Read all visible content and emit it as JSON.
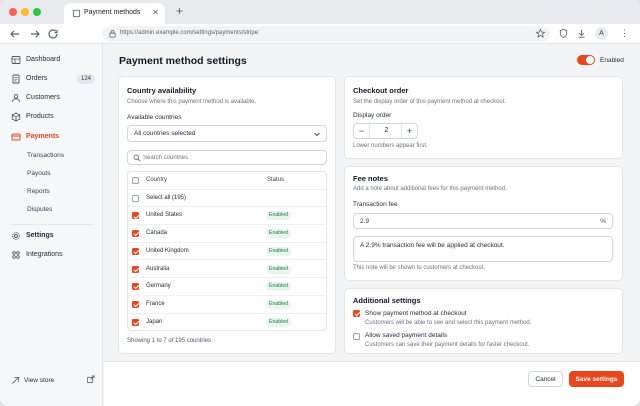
{
  "browser": {
    "tab_title": "Payment methods",
    "url": "https://admin.example.com/settings/payments/stripe",
    "avatar_initial": "A"
  },
  "sidebar": {
    "items": [
      {
        "label": "Dashboard",
        "icon": "dashboard-icon"
      },
      {
        "label": "Orders",
        "icon": "orders-icon",
        "badge": "124"
      },
      {
        "label": "Customers",
        "icon": "customers-icon"
      },
      {
        "label": "Products",
        "icon": "products-icon"
      },
      {
        "label": "Payments",
        "icon": "payments-icon",
        "active": true
      }
    ],
    "payments_sub": [
      "Transactions",
      "Payouts",
      "Reports",
      "Disputes"
    ],
    "settings_label": "Settings",
    "integrations_label": "Integrations",
    "view_store_label": "View store"
  },
  "page": {
    "title": "Payment method settings",
    "enabled_label": "Enabled",
    "enabled": true
  },
  "availability": {
    "title": "Country availability",
    "description": "Choose where this payment method is available.",
    "available_label": "Available countries",
    "selected_value": "All countries selected",
    "search_placeholder": "Search countries",
    "col_country": "Country",
    "col_status": "Status",
    "select_all_label": "Select all (195)",
    "rows": [
      {
        "country": "United States",
        "status": "Enabled",
        "checked": true
      },
      {
        "country": "Canada",
        "status": "Enabled",
        "checked": true
      },
      {
        "country": "United Kingdom",
        "status": "Enabled",
        "checked": true
      },
      {
        "country": "Australia",
        "status": "Enabled",
        "checked": true
      },
      {
        "country": "Germany",
        "status": "Enabled",
        "checked": true
      },
      {
        "country": "France",
        "status": "Enabled",
        "checked": true
      },
      {
        "country": "Japan",
        "status": "Enabled",
        "checked": true
      }
    ],
    "showing": "Showing 1 to 7 of 195 countries"
  },
  "checkout_order": {
    "title": "Checkout order",
    "description": "Set the display order of this payment method at checkout.",
    "display_order_label": "Display order",
    "display_order_value": "2",
    "hint": "Lower numbers appear first."
  },
  "fee_notes": {
    "title": "Fee notes",
    "description": "Add a note about additional fees for this payment method.",
    "fee_label": "Transaction fee",
    "fee_value": "2.9",
    "fee_unit": "%",
    "note_value": "A 2.9% transaction fee will be applied at checkout.",
    "note_hint": "This note will be shown to customers at checkout."
  },
  "additional": {
    "title": "Additional settings",
    "options": [
      {
        "label": "Show payment method at checkout",
        "description": "Customers will be able to see and select this payment method.",
        "checked": true
      },
      {
        "label": "Allow saved payment details",
        "description": "Customers can save their payment details for faster checkout.",
        "checked": false
      }
    ]
  },
  "footer": {
    "cancel_label": "Cancel",
    "save_label": "Save settings"
  },
  "colors": {
    "accent": "#e8461d",
    "enabled_pill_bg": "#e8f5ec",
    "enabled_pill_text": "#1e7d3f"
  }
}
